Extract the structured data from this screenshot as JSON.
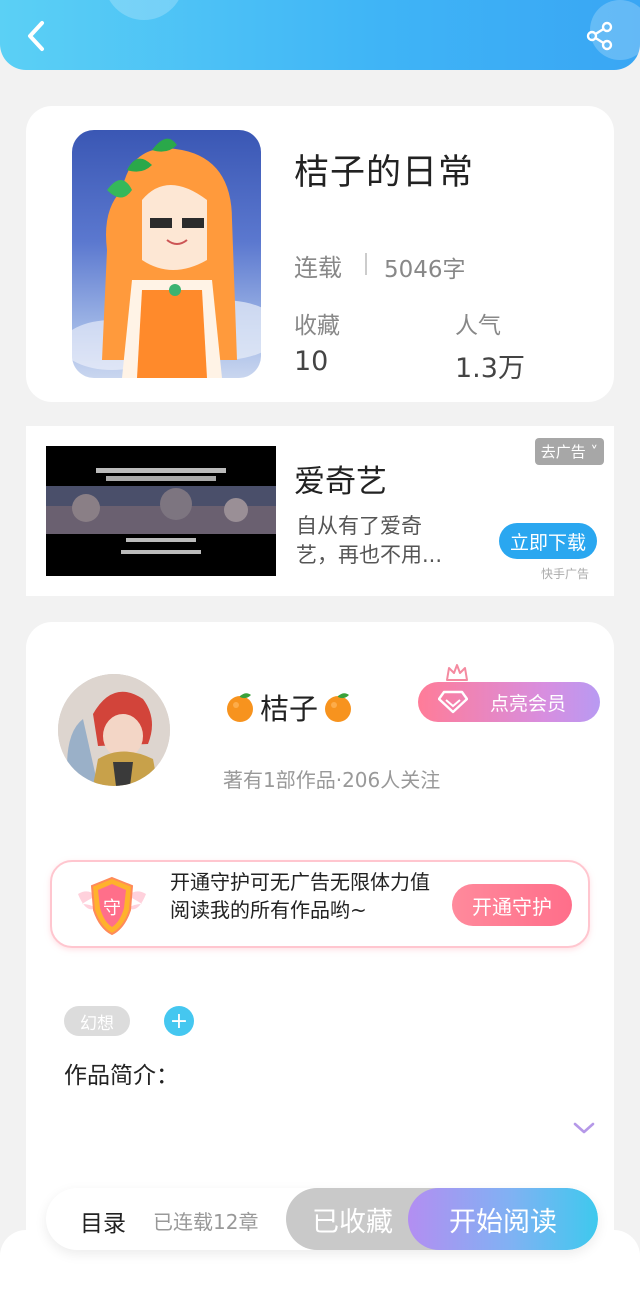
{
  "header": {
    "back_icon": "chevron-left-icon",
    "share_icon": "share-icon"
  },
  "book": {
    "title": "桔子的日常",
    "status": "连载",
    "words": "5046字",
    "favorites_label": "收藏",
    "favorites_value": "10",
    "popularity_label": "人气",
    "popularity_value": "1.3万"
  },
  "ad": {
    "title": "爱奇艺",
    "description_line1": "自从有了爱奇",
    "description_line2": "艺，再也不用...",
    "close_label": "去广告 ˅",
    "download_label": "立即下载",
    "source": "快手广告"
  },
  "author": {
    "name": "桔子",
    "meta": "著有1部作品·206人关注",
    "vip_label": "点亮会员"
  },
  "guard": {
    "text": "开通守护可无广告无限体力值阅读我的所有作品哟~",
    "badge_char": "守",
    "button_label": "开通守护"
  },
  "tags": {
    "items": [
      "幻想"
    ],
    "add_label": "+"
  },
  "intro": {
    "title": "作品简介："
  },
  "bottom_bar": {
    "toc_label": "目录",
    "chapters": "已连载12章",
    "collected_label": "已收藏",
    "read_label": "开始阅读"
  },
  "colors": {
    "header_blue": "#3fb4f6",
    "accent_pink": "#ff7c98",
    "accent_purple": "#b38ef2"
  }
}
